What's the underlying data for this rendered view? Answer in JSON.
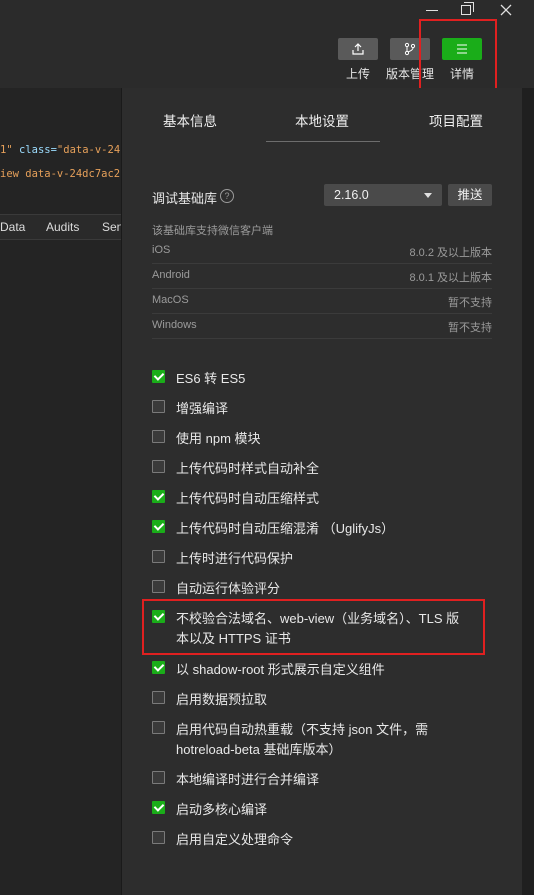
{
  "toolbar": {
    "upload_label": "上传",
    "version_label": "版本管理",
    "details_label": "详情"
  },
  "code": {
    "line1_a": "1\"",
    "line1_b": " class=",
    "line1_c": "\"data-v-24",
    "line2": "iew data-v-24dc7ac2\""
  },
  "devtools_tabs": [
    "Data",
    "Audits",
    "Sen"
  ],
  "tabs": {
    "basic": "基本信息",
    "local": "本地设置",
    "project": "项目配置"
  },
  "lib": {
    "label": "调试基础库",
    "version": "2.16.0",
    "push": "推送",
    "support_title": "该基础库支持微信客户端",
    "clients": [
      {
        "name": "iOS",
        "value": "8.0.2 及以上版本"
      },
      {
        "name": "Android",
        "value": "8.0.1 及以上版本"
      },
      {
        "name": "MacOS",
        "value": "暂不支持"
      },
      {
        "name": "Windows",
        "value": "暂不支持"
      }
    ]
  },
  "options": [
    {
      "label": "ES6 转 ES5",
      "checked": true
    },
    {
      "label": "增强编译",
      "checked": false
    },
    {
      "label": "使用 npm 模块",
      "checked": false
    },
    {
      "label": "上传代码时样式自动补全",
      "checked": false
    },
    {
      "label": "上传代码时自动压缩样式",
      "checked": true
    },
    {
      "label": "上传代码时自动压缩混淆 （UglifyJs）",
      "checked": true
    },
    {
      "label": "上传时进行代码保护",
      "checked": false
    },
    {
      "label": "自动运行体验评分",
      "checked": false
    },
    {
      "label": "不校验合法域名、web-view（业务域名）、TLS 版本以及 HTTPS 证书",
      "checked": true
    },
    {
      "label": "以 shadow-root 形式展示自定义组件",
      "checked": true
    },
    {
      "label": "启用数据预拉取",
      "checked": false
    },
    {
      "label": "启用代码自动热重载（不支持 json 文件，需 hotreload-beta 基础库版本）",
      "checked": false
    },
    {
      "label": "本地编译时进行合并编译",
      "checked": false
    },
    {
      "label": "启动多核心编译",
      "checked": true
    },
    {
      "label": "启用自定义处理命令",
      "checked": false
    }
  ],
  "colors": {
    "accent": "#1aad19",
    "highlight_box": "#e02020"
  }
}
